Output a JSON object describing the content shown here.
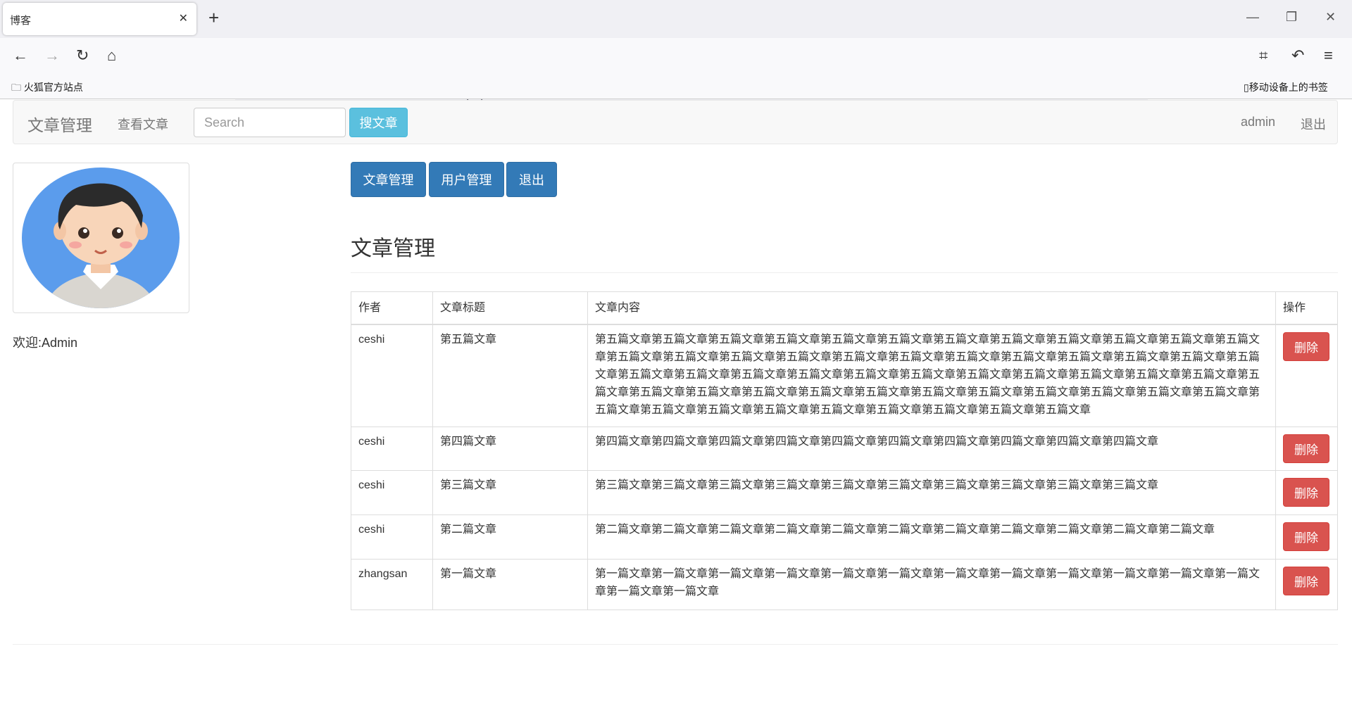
{
  "browser": {
    "tab_title": "博客",
    "url_host": "127.0.0.1",
    "url_path": "/admin/comment_edit.php",
    "bookmark": "火狐官方站点",
    "mobile_bookmarks": "移动设备上的书签"
  },
  "navbar": {
    "brand": "文章管理",
    "view_articles": "查看文章",
    "search_placeholder": "Search",
    "search_button": "搜文章",
    "user": "admin",
    "logout": "退出"
  },
  "sidebar": {
    "welcome": "欢迎:Admin"
  },
  "buttons": {
    "articles": "文章管理",
    "users": "用户管理",
    "logout": "退出"
  },
  "main": {
    "heading": "文章管理"
  },
  "table": {
    "headers": [
      "作者",
      "文章标题",
      "文章内容",
      "操作"
    ],
    "rows": [
      {
        "author": "ceshi",
        "title": "第五篇文章",
        "content": "第五篇文章第五篇文章第五篇文章第五篇文章第五篇文章第五篇文章第五篇文章第五篇文章第五篇文章第五篇文章第五篇文章第五篇文章第五篇文章第五篇文章第五篇文章第五篇文章第五篇文章第五篇文章第五篇文章第五篇文章第五篇文章第五篇文章第五篇文章第五篇文章第五篇文章第五篇文章第五篇文章第五篇文章第五篇文章第五篇文章第五篇文章第五篇文章第五篇文章第五篇文章第五篇文章第五篇文章第五篇文章第五篇文章第五篇文章第五篇文章第五篇文章第五篇文章第五篇文章第五篇文章第五篇文章第五篇文章第五篇文章第五篇文章第五篇文章第五篇文章第五篇文章第五篇文章第五篇文章第五篇文章第五篇文章第五篇文章",
        "action": "删除"
      },
      {
        "author": "ceshi",
        "title": "第四篇文章",
        "content": "第四篇文章第四篇文章第四篇文章第四篇文章第四篇文章第四篇文章第四篇文章第四篇文章第四篇文章第四篇文章",
        "action": "删除"
      },
      {
        "author": "ceshi",
        "title": "第三篇文章",
        "content": "第三篇文章第三篇文章第三篇文章第三篇文章第三篇文章第三篇文章第三篇文章第三篇文章第三篇文章第三篇文章",
        "action": "删除"
      },
      {
        "author": "ceshi",
        "title": "第二篇文章",
        "content": "第二篇文章第二篇文章第二篇文章第二篇文章第二篇文章第二篇文章第二篇文章第二篇文章第二篇文章第二篇文章第二篇文章",
        "action": "删除"
      },
      {
        "author": "zhangsan",
        "title": "第一篇文章",
        "content": "第一篇文章第一篇文章第一篇文章第一篇文章第一篇文章第一篇文章第一篇文章第一篇文章第一篇文章第一篇文章第一篇文章第一篇文章第一篇文章第一篇文章",
        "action": "删除"
      }
    ]
  },
  "colors": {
    "primary": "#337ab7",
    "info": "#5bc0de",
    "danger": "#d9534f"
  }
}
